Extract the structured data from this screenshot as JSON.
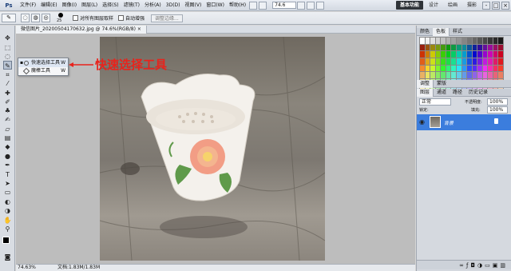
{
  "app": {
    "logo": "Ps"
  },
  "menu": [
    "文件(F)",
    "编辑(E)",
    "图像(I)",
    "图层(L)",
    "选择(S)",
    "滤镜(T)",
    "分析(A)",
    "3D(D)",
    "视图(V)",
    "窗口(W)",
    "帮助(H)"
  ],
  "menubar": {
    "zoom": "74.6",
    "workspaces": [
      "基本功能",
      "设计",
      "绘画",
      "摄影"
    ],
    "active_workspace": "基本功能"
  },
  "options": {
    "brush_size": "25",
    "sample_all_layers": "对所有图层取样",
    "auto_enhance": "自动增强",
    "refine_edge": "调整边缘..."
  },
  "document": {
    "tab_title": "微信图片_20200504170632.jpg @ 74.6%(RGB/8) ×",
    "status_zoom": "74.63%",
    "status_doc": "文档:1.83M/1.83M"
  },
  "flyout": {
    "items": [
      {
        "label": "快速选择工具",
        "key": "W",
        "selected": true
      },
      {
        "label": "魔棒工具",
        "key": "W",
        "selected": false
      }
    ]
  },
  "annotation": {
    "text": "快速选择工具",
    "color": "#e8231c"
  },
  "panels": {
    "color_tabs": [
      "颜色",
      "色板",
      "样式"
    ],
    "adjust_tabs": [
      "调整",
      "蒙版"
    ],
    "layer_tabs": [
      "图层",
      "通道",
      "路径",
      "历史记录"
    ],
    "blend_mode": "正常",
    "opacity_label": "不透明度:",
    "opacity": "100%",
    "lock_label": "锁定:",
    "fill_label": "填充:",
    "fill": "100%",
    "layer_name": "背景"
  },
  "colors": {
    "accent": "#3b7ddd",
    "workspace_active_bg": "#2f3338",
    "annotation": "#e8231c"
  }
}
